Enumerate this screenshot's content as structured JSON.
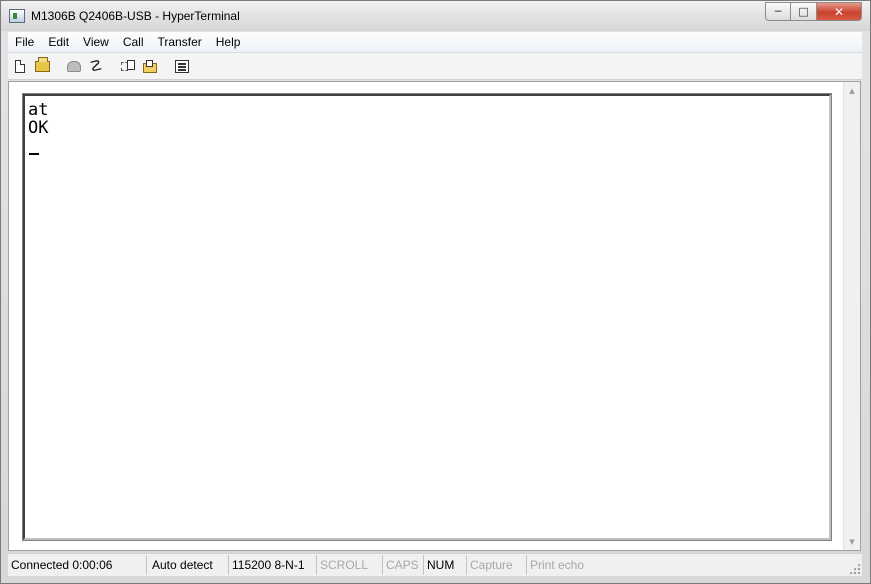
{
  "window": {
    "title": "M1306B Q2406B-USB - HyperTerminal",
    "minimize_glyph": "─",
    "maximize_glyph": "□",
    "close_glyph": "✕"
  },
  "menu": {
    "items": [
      "File",
      "Edit",
      "View",
      "Call",
      "Transfer",
      "Help"
    ]
  },
  "toolbar": {
    "icons": [
      "new-document-icon",
      "open-folder-icon",
      "call-phone-icon",
      "disconnect-icon",
      "send-file-icon",
      "receive-file-icon",
      "properties-icon"
    ]
  },
  "terminal": {
    "lines": [
      "at",
      "OK"
    ],
    "cursor": "_"
  },
  "status": {
    "connected": "Connected 0:00:06",
    "detect": "Auto detect",
    "port_settings": "115200 8-N-1",
    "scroll": "SCROLL",
    "caps": "CAPS",
    "num": "NUM",
    "capture": "Capture",
    "print_echo": "Print echo"
  },
  "colors": {
    "close_button": "#c8432f",
    "disabled_text": "#a8a8a8"
  }
}
